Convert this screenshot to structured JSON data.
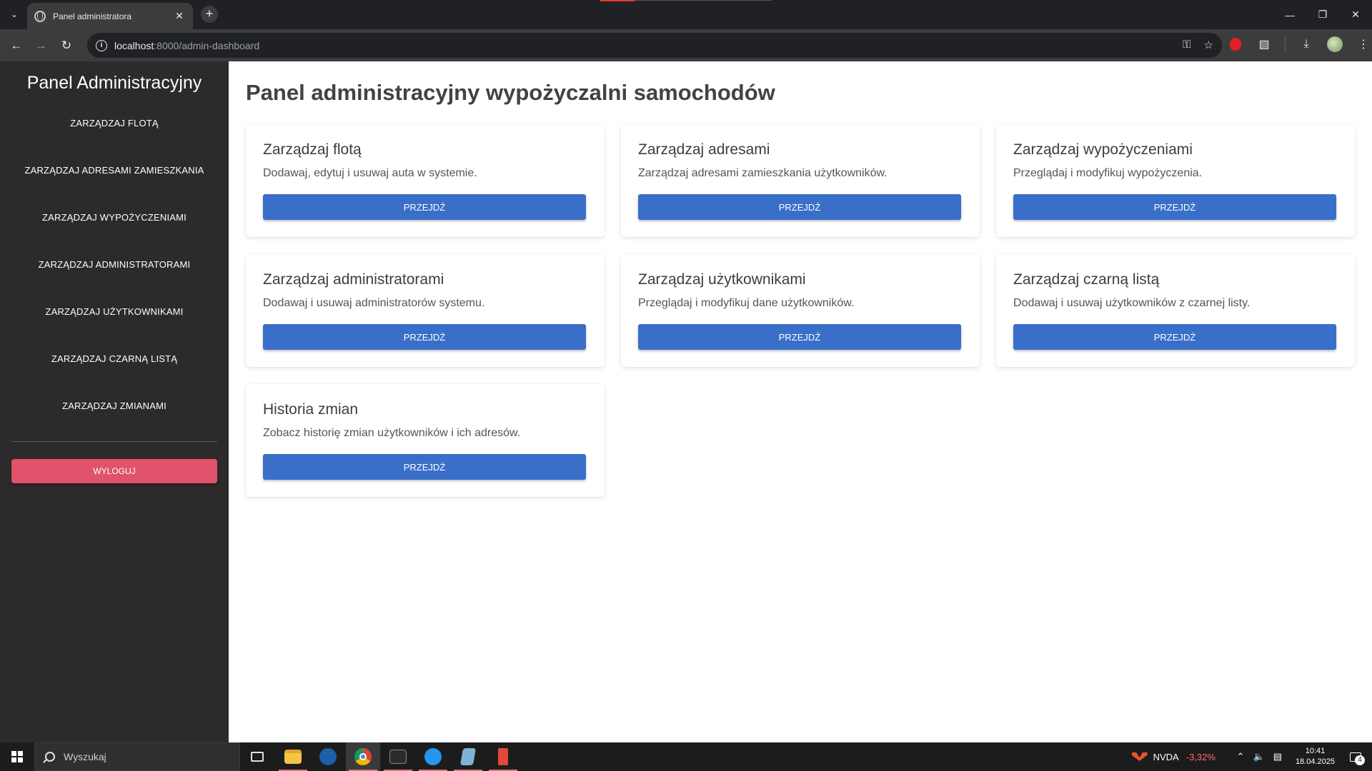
{
  "browser": {
    "tab_title": "Panel administratora",
    "url_host": "localhost",
    "url_path": ":8000/admin-dashboard"
  },
  "sidebar": {
    "title": "Panel Administracyjny",
    "items": [
      {
        "label": "Zarządzaj flotą"
      },
      {
        "label": "Zarządzaj adresami zamieszkania"
      },
      {
        "label": "Zarządzaj wypożyczeniami"
      },
      {
        "label": "Zarządzaj administratorami"
      },
      {
        "label": "Zarządzaj użytkownikami"
      },
      {
        "label": "Zarządzaj czarną listą"
      },
      {
        "label": "Zarządzaj zmianami"
      }
    ],
    "logout_label": "Wyloguj"
  },
  "main": {
    "title": "Panel administracyjny wypożyczalni samochodów",
    "cards": [
      {
        "title": "Zarządzaj flotą",
        "description": "Dodawaj, edytuj i usuwaj auta w systemie.",
        "button": "Przejdź"
      },
      {
        "title": "Zarządzaj adresami",
        "description": "Zarządzaj adresami zamieszkania użytkowników.",
        "button": "Przejdź"
      },
      {
        "title": "Zarządzaj wypożyczeniami",
        "description": "Przeglądaj i modyfikuj wypożyczenia.",
        "button": "Przejdź"
      },
      {
        "title": "Zarządzaj administratorami",
        "description": "Dodawaj i usuwaj administratorów systemu.",
        "button": "Przejdź"
      },
      {
        "title": "Zarządzaj użytkownikami",
        "description": "Przeglądaj i modyfikuj dane użytkowników.",
        "button": "Przejdź"
      },
      {
        "title": "Zarządzaj czarną listą",
        "description": "Dodawaj i usuwaj użytkowników z czarnej listy.",
        "button": "Przejdź"
      },
      {
        "title": "Historia zmian",
        "description": "Zobacz historię zmian użytkowników i ich adresów.",
        "button": "Przejdź"
      }
    ]
  },
  "taskbar": {
    "search_placeholder": "Wyszukaj",
    "stock_name": "NVDA",
    "stock_change": "-3,32%",
    "time": "10:41",
    "date": "18.04.2025",
    "notification_count": "4"
  },
  "colors": {
    "sidebar_bg": "#2d2a2b",
    "primary_button": "#3a6fc9",
    "logout_button": "#e0536a"
  }
}
